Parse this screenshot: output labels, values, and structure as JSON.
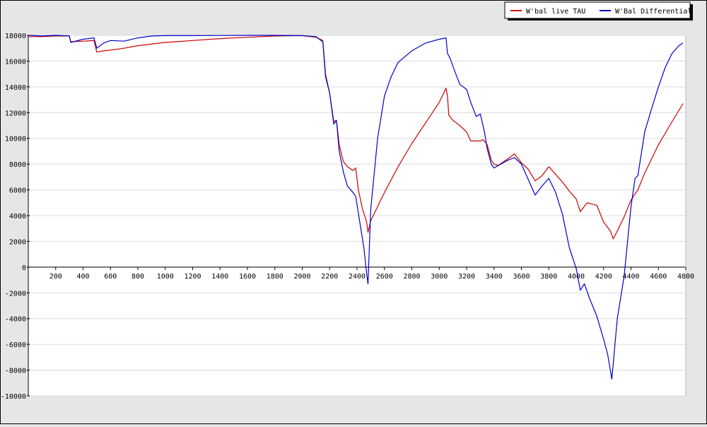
{
  "chart_data": {
    "type": "line",
    "title": "",
    "xlabel": "",
    "ylabel": "",
    "xlim": [
      0,
      4800
    ],
    "ylim": [
      -10000,
      18000
    ],
    "x_ticks": [
      200,
      400,
      600,
      800,
      1000,
      1200,
      1400,
      1600,
      1800,
      2000,
      2200,
      2400,
      2600,
      2800,
      3000,
      3200,
      3400,
      3600,
      3800,
      4000,
      4200,
      4400,
      4600,
      4800
    ],
    "y_ticks": [
      -10000,
      -8000,
      -6000,
      -4000,
      -2000,
      0,
      2000,
      4000,
      6000,
      8000,
      10000,
      12000,
      14000,
      16000,
      18000
    ],
    "grid": "horizontal",
    "legend_position": "top-right",
    "colors": {
      "background": "#e6e6e6",
      "plot_bg": "#ffffff",
      "grid": "#dcdcdc"
    },
    "series": [
      {
        "name": "W'bal live TAU",
        "color": "#cc0000",
        "points": [
          [
            0,
            17900
          ],
          [
            100,
            17900
          ],
          [
            200,
            17950
          ],
          [
            300,
            17950
          ],
          [
            310,
            17500
          ],
          [
            400,
            17550
          ],
          [
            480,
            17600
          ],
          [
            500,
            16700
          ],
          [
            550,
            16800
          ],
          [
            600,
            16850
          ],
          [
            700,
            17000
          ],
          [
            800,
            17200
          ],
          [
            1000,
            17450
          ],
          [
            1200,
            17600
          ],
          [
            1400,
            17750
          ],
          [
            1600,
            17850
          ],
          [
            1800,
            17950
          ],
          [
            2000,
            17980
          ],
          [
            2100,
            17850
          ],
          [
            2150,
            17600
          ],
          [
            2170,
            15000
          ],
          [
            2200,
            13500
          ],
          [
            2230,
            11300
          ],
          [
            2250,
            11400
          ],
          [
            2270,
            9500
          ],
          [
            2300,
            8200
          ],
          [
            2330,
            7800
          ],
          [
            2370,
            7500
          ],
          [
            2390,
            7700
          ],
          [
            2410,
            6000
          ],
          [
            2440,
            4500
          ],
          [
            2470,
            3500
          ],
          [
            2480,
            2700
          ],
          [
            2500,
            3600
          ],
          [
            2550,
            4700
          ],
          [
            2600,
            5800
          ],
          [
            2700,
            7800
          ],
          [
            2800,
            9600
          ],
          [
            2900,
            11200
          ],
          [
            3000,
            12800
          ],
          [
            3050,
            13900
          ],
          [
            3060,
            13300
          ],
          [
            3070,
            11800
          ],
          [
            3100,
            11400
          ],
          [
            3150,
            11000
          ],
          [
            3200,
            10500
          ],
          [
            3230,
            9800
          ],
          [
            3300,
            9800
          ],
          [
            3320,
            9900
          ],
          [
            3350,
            9500
          ],
          [
            3380,
            8300
          ],
          [
            3400,
            8000
          ],
          [
            3430,
            7900
          ],
          [
            3500,
            8400
          ],
          [
            3550,
            8800
          ],
          [
            3600,
            8100
          ],
          [
            3650,
            7600
          ],
          [
            3700,
            6700
          ],
          [
            3750,
            7100
          ],
          [
            3800,
            7800
          ],
          [
            3850,
            7200
          ],
          [
            3900,
            6600
          ],
          [
            3950,
            5900
          ],
          [
            4000,
            5300
          ],
          [
            4030,
            4300
          ],
          [
            4080,
            5000
          ],
          [
            4150,
            4800
          ],
          [
            4200,
            3500
          ],
          [
            4250,
            2800
          ],
          [
            4270,
            2200
          ],
          [
            4300,
            2800
          ],
          [
            4350,
            3900
          ],
          [
            4400,
            5200
          ],
          [
            4450,
            6000
          ],
          [
            4500,
            7300
          ],
          [
            4600,
            9500
          ],
          [
            4700,
            11300
          ],
          [
            4780,
            12700
          ]
        ]
      },
      {
        "name": "W'Bal Differential",
        "color": "#0000cc",
        "points": [
          [
            0,
            18000
          ],
          [
            100,
            17950
          ],
          [
            200,
            18000
          ],
          [
            300,
            17950
          ],
          [
            310,
            17450
          ],
          [
            400,
            17700
          ],
          [
            480,
            17800
          ],
          [
            500,
            17000
          ],
          [
            550,
            17400
          ],
          [
            600,
            17600
          ],
          [
            700,
            17550
          ],
          [
            800,
            17800
          ],
          [
            900,
            17950
          ],
          [
            1000,
            17980
          ],
          [
            1200,
            17980
          ],
          [
            1400,
            17990
          ],
          [
            1600,
            18000
          ],
          [
            1800,
            18000
          ],
          [
            2000,
            17980
          ],
          [
            2100,
            17900
          ],
          [
            2150,
            17500
          ],
          [
            2170,
            14800
          ],
          [
            2200,
            13500
          ],
          [
            2230,
            11100
          ],
          [
            2250,
            11400
          ],
          [
            2270,
            9000
          ],
          [
            2300,
            7400
          ],
          [
            2330,
            6300
          ],
          [
            2370,
            5800
          ],
          [
            2390,
            5500
          ],
          [
            2420,
            3500
          ],
          [
            2450,
            1500
          ],
          [
            2470,
            -500
          ],
          [
            2480,
            -1300
          ],
          [
            2500,
            4500
          ],
          [
            2550,
            10000
          ],
          [
            2600,
            13300
          ],
          [
            2650,
            14800
          ],
          [
            2700,
            15900
          ],
          [
            2800,
            16800
          ],
          [
            2900,
            17400
          ],
          [
            3000,
            17700
          ],
          [
            3050,
            17800
          ],
          [
            3060,
            16600
          ],
          [
            3080,
            16200
          ],
          [
            3100,
            15600
          ],
          [
            3150,
            14200
          ],
          [
            3200,
            13800
          ],
          [
            3230,
            12800
          ],
          [
            3270,
            11700
          ],
          [
            3300,
            11900
          ],
          [
            3330,
            10500
          ],
          [
            3350,
            9200
          ],
          [
            3380,
            8000
          ],
          [
            3400,
            7700
          ],
          [
            3450,
            8000
          ],
          [
            3500,
            8300
          ],
          [
            3550,
            8500
          ],
          [
            3600,
            8000
          ],
          [
            3650,
            6800
          ],
          [
            3700,
            5600
          ],
          [
            3750,
            6300
          ],
          [
            3800,
            6900
          ],
          [
            3850,
            5800
          ],
          [
            3900,
            4100
          ],
          [
            3950,
            1500
          ],
          [
            4000,
            -100
          ],
          [
            4030,
            -1800
          ],
          [
            4060,
            -1300
          ],
          [
            4100,
            -2500
          ],
          [
            4150,
            -3800
          ],
          [
            4200,
            -5600
          ],
          [
            4230,
            -6800
          ],
          [
            4260,
            -8700
          ],
          [
            4300,
            -4000
          ],
          [
            4350,
            -700
          ],
          [
            4400,
            4700
          ],
          [
            4430,
            6900
          ],
          [
            4450,
            7100
          ],
          [
            4500,
            10500
          ],
          [
            4550,
            12300
          ],
          [
            4600,
            14000
          ],
          [
            4650,
            15500
          ],
          [
            4700,
            16600
          ],
          [
            4750,
            17200
          ],
          [
            4780,
            17400
          ]
        ]
      }
    ]
  }
}
